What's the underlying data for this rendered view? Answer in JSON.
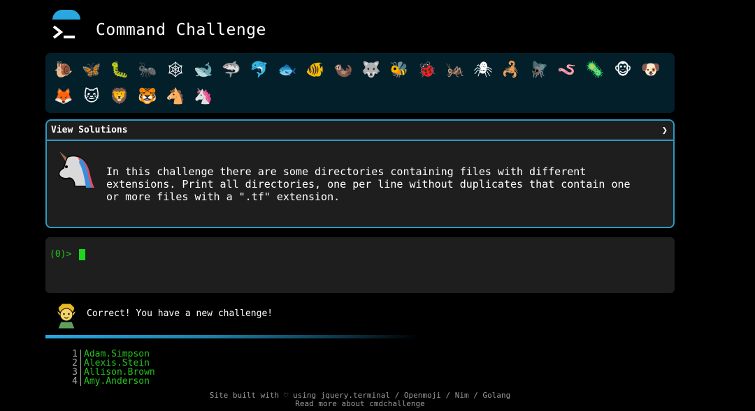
{
  "header": {
    "title": "Command Challenge",
    "logo": "terminal-logo"
  },
  "levels": [
    {
      "glyph": "🐌",
      "name": "snail"
    },
    {
      "glyph": "🦋",
      "name": "butterfly"
    },
    {
      "glyph": "🐛",
      "name": "caterpillar"
    },
    {
      "glyph": "🐜",
      "name": "ant"
    },
    {
      "glyph": "🕸",
      "name": "web"
    },
    {
      "glyph": "🐋",
      "name": "whale"
    },
    {
      "glyph": "🦈",
      "name": "shark"
    },
    {
      "glyph": "🐬",
      "name": "dolphin"
    },
    {
      "glyph": "🐟",
      "name": "fish"
    },
    {
      "glyph": "🐠",
      "name": "tropical-fish"
    },
    {
      "glyph": "🦦",
      "name": "otter"
    },
    {
      "glyph": "🐺",
      "name": "wolf"
    },
    {
      "glyph": "🐝",
      "name": "bee"
    },
    {
      "glyph": "🐞",
      "name": "ladybug"
    },
    {
      "glyph": "🦗",
      "name": "cricket"
    },
    {
      "glyph": "🕷",
      "name": "spider"
    },
    {
      "glyph": "🦂",
      "name": "scorpion"
    },
    {
      "glyph": "🪰",
      "name": "fly"
    },
    {
      "glyph": "🪱",
      "name": "worm"
    },
    {
      "glyph": "🦠",
      "name": "microbe"
    },
    {
      "glyph": "🐵",
      "name": "monkey"
    },
    {
      "glyph": "🐶",
      "name": "dog"
    },
    {
      "glyph": "🦊",
      "name": "fox"
    },
    {
      "glyph": "🐱",
      "name": "cat"
    },
    {
      "glyph": "🦁",
      "name": "lion"
    },
    {
      "glyph": "🐯",
      "name": "tiger"
    },
    {
      "glyph": "🐴",
      "name": "horse"
    },
    {
      "glyph": "🦄",
      "name": "unicorn"
    }
  ],
  "challenge": {
    "solutions_label": "View Solutions",
    "solutions_chevron": "❯",
    "avatar": "unicorn-avatar",
    "description": "In this challenge there are some directories containing files with different\nextensions. Print all directories, one per line without duplicates that contain one\nor more files with a \".tf\" extension."
  },
  "terminal": {
    "prompt": "(0)>"
  },
  "status": {
    "avatar": "elf-avatar",
    "message": "Correct! You have a new challenge!"
  },
  "leaderboard": [
    {
      "rank": "1",
      "name": "Adam.Simpson"
    },
    {
      "rank": "2",
      "name": "Alexis.Stein"
    },
    {
      "rank": "3",
      "name": "Allison.Brown"
    },
    {
      "rank": "4",
      "name": "Amy.Anderson"
    }
  ],
  "footer": {
    "built_prefix": "Site built with ",
    "heart": "♡",
    "built_middle": " using ",
    "link_jquery": "jquery.terminal",
    "sep1": " / ",
    "link_openmoji": "Openmoji",
    "sep2": " / ",
    "link_nim": "Nim",
    "sep3": " / ",
    "link_golang": "Golang",
    "read_more": "Read more about cmdchallenge"
  },
  "colors": {
    "accent": "#29a8e0",
    "prompt_green": "#26c21f",
    "panel_bg": "#03202a",
    "box_bg": "#1e1e1e"
  }
}
